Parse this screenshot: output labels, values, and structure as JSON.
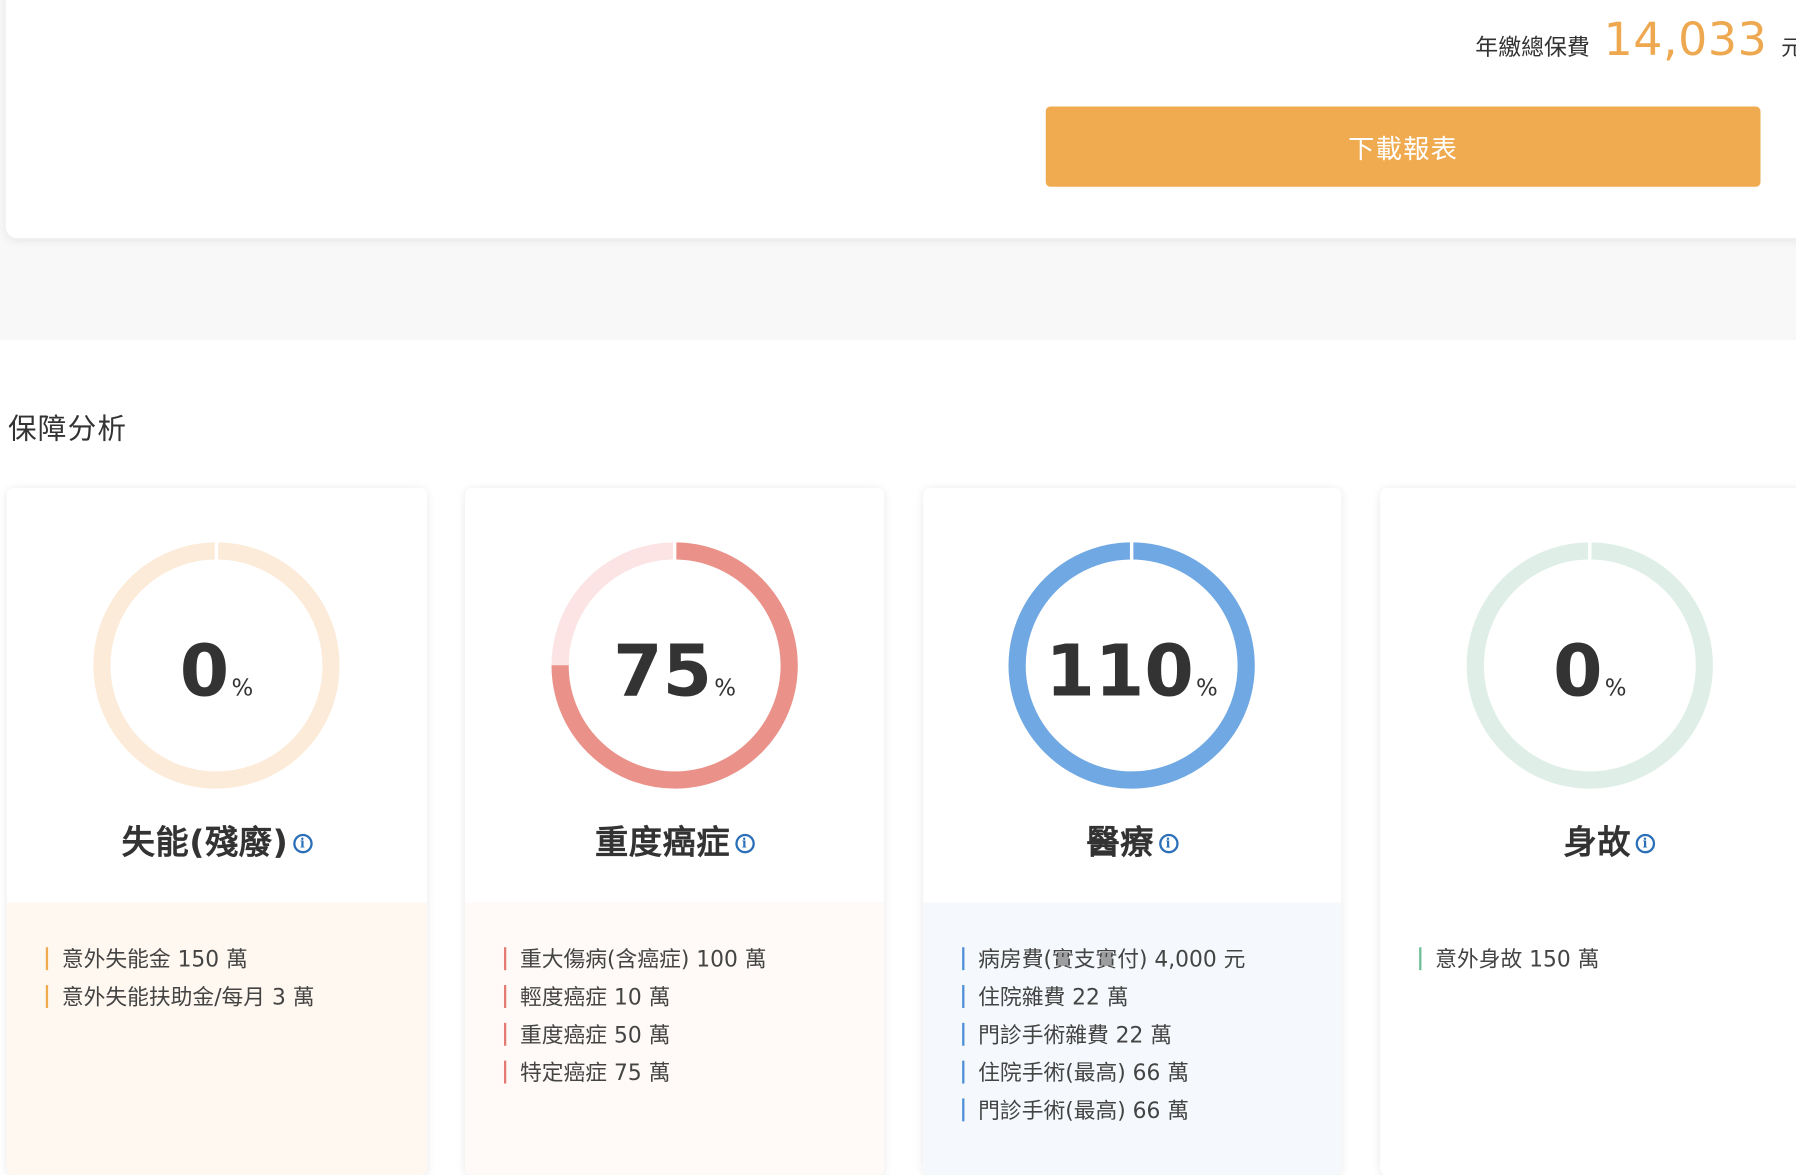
{
  "summary": {
    "premium_label": "年繳總保費",
    "premium_amount": "14,033",
    "premium_unit": "元",
    "download_label": "下載報表"
  },
  "analysis": {
    "title": "保障分析",
    "cards": [
      {
        "name": "失能(殘廢)",
        "percent": 0,
        "percent_text": "0",
        "percent_sign": "%",
        "ring_color": "#f0ab51",
        "track_color": "#fcebd8",
        "panel_color": "#fff8f0",
        "bar_color": "#f0ab51",
        "info_icon": "info-icon",
        "items": [
          "意外失能金 150 萬",
          "意外失能扶助金/每月 3 萬"
        ]
      },
      {
        "name": "重度癌症",
        "percent": 75,
        "percent_text": "75",
        "percent_sign": "%",
        "ring_color": "#ea9289",
        "track_color": "#fbe4e3",
        "panel_color": "#fffaf7",
        "bar_color": "#e37a73",
        "info_icon": "info-icon",
        "items": [
          "重大傷病(含癌症) 100 萬",
          "輕度癌症 10 萬",
          "重度癌症 50 萬",
          "特定癌症 75 萬"
        ]
      },
      {
        "name": "醫療",
        "percent": 110,
        "percent_text": "110",
        "percent_sign": "%",
        "ring_color": "#6fa8e2",
        "track_color": "#dbe9f7",
        "panel_color": "#f5f9fd",
        "bar_color": "#4e8fd6",
        "info_icon": "info-icon",
        "items": [
          "病房費(實支實付) 4,000 元",
          "住院雜費 22 萬",
          "門診手術雜費 22 萬",
          "住院手術(最高) 66 萬",
          "門診手術(最高) 66 萬"
        ]
      },
      {
        "name": "身故",
        "percent": 0,
        "percent_text": "0",
        "percent_sign": "%",
        "ring_color": "#7fc8a4",
        "track_color": "#dfefe7",
        "panel_color": "#ffffff",
        "bar_color": "#6cbf97",
        "info_icon": "info-icon",
        "items": [
          "意外身故 150 萬"
        ]
      }
    ]
  }
}
